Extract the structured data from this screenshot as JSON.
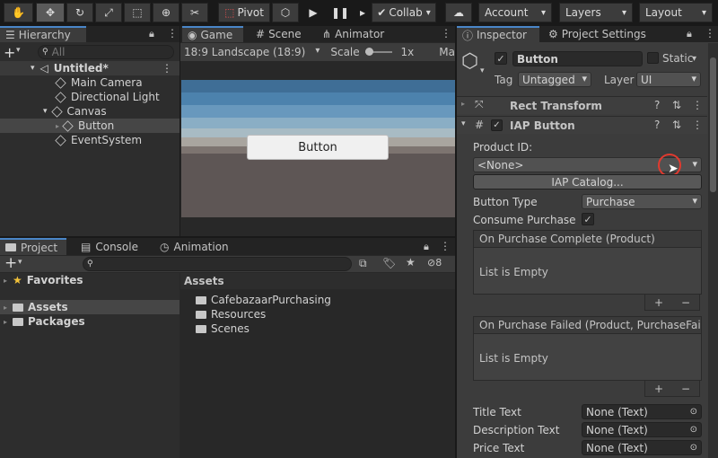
{
  "toolbar": {
    "pivot": "Pivot",
    "collab": "Collab",
    "account": "Account",
    "layers": "Layers",
    "layout": "Layout"
  },
  "hierarchy": {
    "tab": "Hierarchy",
    "search_placeholder": "All",
    "scene": "Untitled*",
    "items": [
      "Main Camera",
      "Directional Light",
      "Canvas",
      "Button",
      "EventSystem"
    ]
  },
  "game": {
    "tabs": [
      "Game",
      "Scene",
      "Animator"
    ],
    "aspect": "18:9 Landscape (18:9)",
    "scale_label": "Scale",
    "scale_value": "1x",
    "maximize": "Ma",
    "button_label": "Button"
  },
  "project": {
    "tabs": [
      "Project",
      "Console",
      "Animation"
    ],
    "favorites": "Favorites",
    "assets": "Assets",
    "packages": "Packages",
    "assets_header": "Assets",
    "folders": [
      "CafebazaarPurchasing",
      "Resources",
      "Scenes"
    ],
    "hidden_count": "8"
  },
  "inspector": {
    "tabs": [
      "Inspector",
      "Project Settings"
    ],
    "object_name": "Button",
    "static_label": "Static",
    "tag_label": "Tag",
    "tag_value": "Untagged",
    "layer_label": "Layer",
    "layer_value": "UI",
    "rect_transform": "Rect Transform",
    "iap_button": "IAP Button",
    "product_id_label": "Product ID:",
    "product_id_value": "<None>",
    "iap_catalog": "IAP Catalog...",
    "button_type_label": "Button Type",
    "button_type_value": "Purchase",
    "consume_label": "Consume Purchase",
    "on_complete": "On Purchase Complete (Product)",
    "list_empty": "List is Empty",
    "on_failed": "On Purchase Failed (Product, PurchaseFailu",
    "title_text": "Title Text",
    "description_text": "Description Text",
    "price_text": "Price Text",
    "none_text": "None (Text)"
  }
}
